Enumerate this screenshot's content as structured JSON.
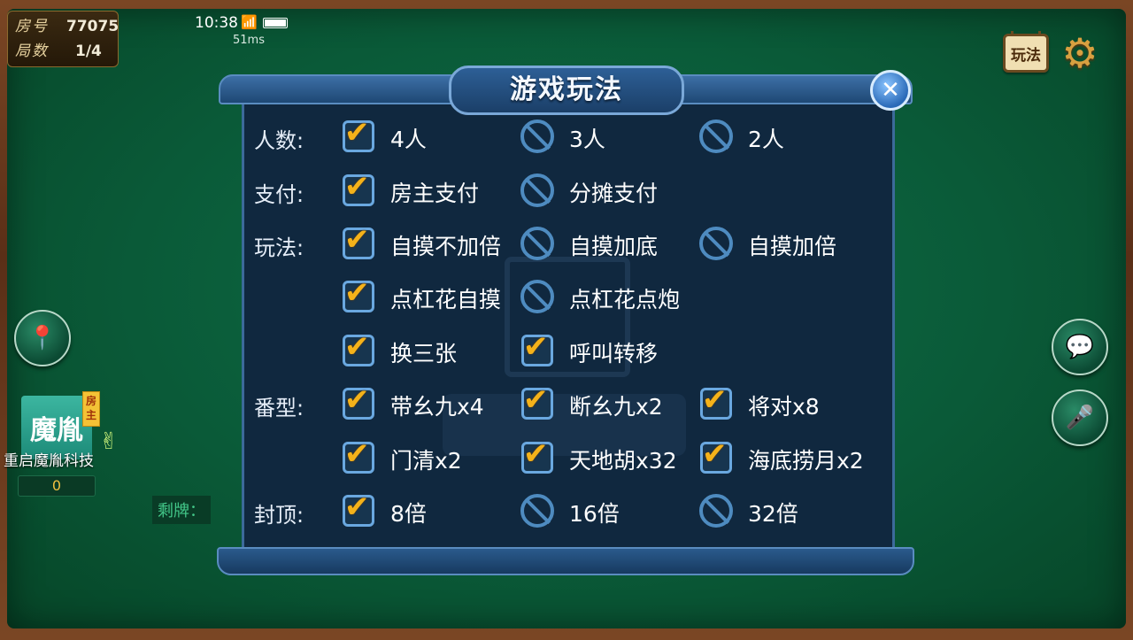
{
  "room": {
    "room_label": "房号",
    "room_no": "77075",
    "round_label": "局数",
    "round": "1/4"
  },
  "status": {
    "time": "10:38",
    "ping": "51ms",
    "wifi_icon": "wifi-icon",
    "battery_icon": "battery-icon"
  },
  "toolbar": {
    "rules_label": "玩法",
    "settings_icon": "gear-icon"
  },
  "player": {
    "avatar_text": "魔胤",
    "owner_badge": "房主",
    "name": "重启魔胤科技",
    "score": "0"
  },
  "table": {
    "remaining_label": "剩牌："
  },
  "dialog": {
    "title": "游戏玩法",
    "rows": [
      {
        "label": "人数:",
        "options": [
          {
            "text": "4人",
            "checked": true
          },
          {
            "text": "3人",
            "checked": false
          },
          {
            "text": "2人",
            "checked": false
          }
        ]
      },
      {
        "label": "支付:",
        "options": [
          {
            "text": "房主支付",
            "checked": true
          },
          {
            "text": "分摊支付",
            "checked": false
          }
        ]
      },
      {
        "label": "玩法:",
        "options": [
          {
            "text": "自摸不加倍",
            "checked": true
          },
          {
            "text": "自摸加底",
            "checked": false
          },
          {
            "text": "自摸加倍",
            "checked": false
          }
        ]
      },
      {
        "label": "",
        "options": [
          {
            "text": "点杠花自摸",
            "checked": true
          },
          {
            "text": "点杠花点炮",
            "checked": false
          }
        ]
      },
      {
        "label": "",
        "options": [
          {
            "text": "换三张",
            "checked": true
          },
          {
            "text": "呼叫转移",
            "checked": true
          }
        ]
      },
      {
        "label": "番型:",
        "options": [
          {
            "text": "带幺九x4",
            "checked": true
          },
          {
            "text": "断幺九x2",
            "checked": true
          },
          {
            "text": "将对x8",
            "checked": true
          }
        ]
      },
      {
        "label": "",
        "options": [
          {
            "text": "门清x2",
            "checked": true
          },
          {
            "text": "天地胡x32",
            "checked": true
          },
          {
            "text": "海底捞月x2",
            "checked": true
          }
        ]
      },
      {
        "label": "封顶:",
        "options": [
          {
            "text": "8倍",
            "checked": true
          },
          {
            "text": "16倍",
            "checked": false
          },
          {
            "text": "32倍",
            "checked": false
          }
        ]
      }
    ]
  }
}
